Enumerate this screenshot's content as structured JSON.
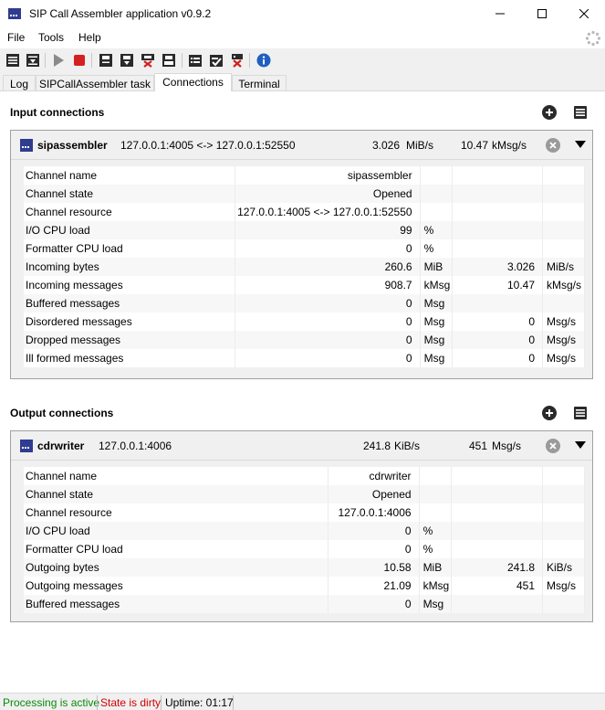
{
  "window": {
    "title": "SIP Call Assembler application v0.9.2"
  },
  "menu": {
    "items": [
      "File",
      "Tools",
      "Help"
    ]
  },
  "tabs": [
    {
      "label": "Log",
      "active": false
    },
    {
      "label": "SIPCallAssembler task",
      "active": false
    },
    {
      "label": "Connections",
      "active": true
    },
    {
      "label": "Terminal",
      "active": false
    }
  ],
  "input": {
    "section_title": "Input connections",
    "connection": {
      "name": "sipassembler",
      "address": "127.0.0.1:4005 <-> 127.0.0.1:52550",
      "byte_rate": "3.026",
      "byte_rate_unit": "MiB/s",
      "msg_rate": "10.47",
      "msg_rate_unit": "kMsg/s"
    },
    "rows": [
      [
        "Channel name",
        "sipassembler",
        "",
        "",
        ""
      ],
      [
        "Channel state",
        "Opened",
        "",
        "",
        ""
      ],
      [
        "Channel resource",
        "127.0.0.1:4005 <-> 127.0.0.1:52550",
        "",
        "",
        ""
      ],
      [
        "I/O CPU load",
        "99",
        "%",
        "",
        ""
      ],
      [
        "Formatter CPU load",
        "0",
        "%",
        "",
        ""
      ],
      [
        "Incoming bytes",
        "260.6",
        "MiB",
        "3.026",
        "MiB/s"
      ],
      [
        "Incoming messages",
        "908.7",
        "kMsg",
        "10.47",
        "kMsg/s"
      ],
      [
        "Buffered messages",
        "0",
        "Msg",
        "",
        ""
      ],
      [
        "Disordered messages",
        "0",
        "Msg",
        "0",
        "Msg/s"
      ],
      [
        "Dropped messages",
        "0",
        "Msg",
        "0",
        "Msg/s"
      ],
      [
        "Ill formed messages",
        "0",
        "Msg",
        "0",
        "Msg/s"
      ]
    ]
  },
  "output": {
    "section_title": "Output connections",
    "connection": {
      "name": "cdrwriter",
      "address": "127.0.0.1:4006",
      "byte_rate": "241.8",
      "byte_rate_unit": "KiB/s",
      "msg_rate": "451",
      "msg_rate_unit": "Msg/s"
    },
    "rows": [
      [
        "Channel name",
        "cdrwriter",
        "",
        "",
        ""
      ],
      [
        "Channel state",
        "Opened",
        "",
        "",
        ""
      ],
      [
        "Channel resource",
        "127.0.0.1:4006",
        "",
        "",
        ""
      ],
      [
        "I/O CPU load",
        "0",
        "%",
        "",
        ""
      ],
      [
        "Formatter CPU load",
        "0",
        "%",
        "",
        ""
      ],
      [
        "Outgoing bytes",
        "10.58",
        "MiB",
        "241.8",
        "KiB/s"
      ],
      [
        "Outgoing messages",
        "21.09",
        "kMsg",
        "451",
        "Msg/s"
      ],
      [
        "Buffered messages",
        "0",
        "Msg",
        "",
        ""
      ]
    ]
  },
  "status": {
    "processing": "Processing is active",
    "state": "State is dirty",
    "uptime": "Uptime: 01:17",
    "processing_color": "#0a8a0a",
    "state_color": "#d40000"
  },
  "icons": {
    "toolbar": [
      "bars-icon",
      "bars-arrow-icon",
      "play-icon",
      "stop-icon",
      "save-icon",
      "save-all-icon",
      "delete-icon",
      "eject-icon",
      "clipboard-icon",
      "clipboard-check-icon",
      "clipboard-delete-icon",
      "info-icon"
    ]
  }
}
